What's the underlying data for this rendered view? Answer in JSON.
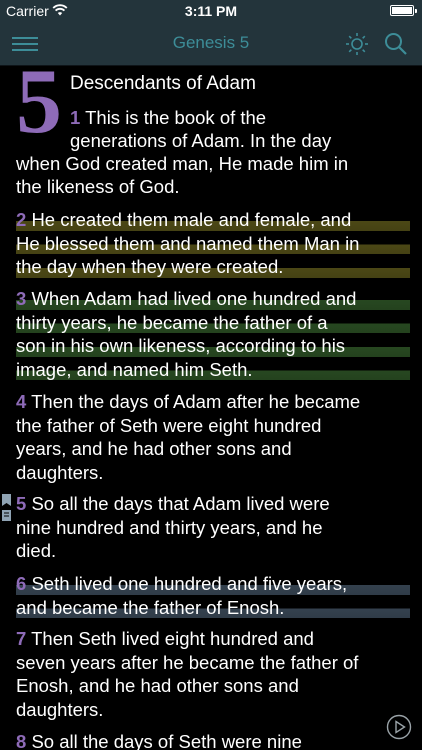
{
  "status": {
    "carrier": "Carrier",
    "time": "3:11 PM"
  },
  "nav": {
    "title": "Genesis 5"
  },
  "chapter": {
    "number": "5",
    "heading": "Descendants of Adam"
  },
  "verses": [
    {
      "num": "1",
      "lines": [
        "This is the book of the",
        "generations of Adam. In the day",
        "when God created man, He made him in",
        "the likeness of God."
      ]
    },
    {
      "num": "2",
      "lines": [
        "He created them male and female, and",
        "He blessed them and named them Man in",
        "the day when they were created."
      ]
    },
    {
      "num": "3",
      "lines": [
        "When Adam had lived one hundred and",
        "thirty years, he became the father of a",
        "son in his own likeness, according to his",
        "image, and named him Seth."
      ]
    },
    {
      "num": "4",
      "lines": [
        "Then the days of Adam after he became",
        "the father of Seth were eight hundred",
        "years, and he had other sons and",
        "daughters."
      ]
    },
    {
      "num": "5",
      "lines": [
        "So all the days that Adam lived were",
        "nine hundred and thirty years, and he",
        "died."
      ]
    },
    {
      "num": "6",
      "lines": [
        "Seth lived one hundred and five years,",
        "and became the father of Enosh."
      ]
    },
    {
      "num": "7",
      "lines": [
        "Then Seth lived eight hundred and",
        "seven years after he became the father of",
        "Enosh, and he had other sons and",
        "daughters."
      ]
    },
    {
      "num": "8",
      "lines": [
        "So all the days of Seth were nine"
      ]
    }
  ],
  "icons": {
    "menu": "menu-icon",
    "brightness": "brightness-icon",
    "search": "search-icon",
    "bookmark": "bookmark-icon",
    "play": "play-icon",
    "wifi": "wifi-icon",
    "battery": "battery-icon"
  },
  "colors": {
    "bar": "#23343b",
    "accent": "#3d8d98",
    "verse_number": "#8e6bb8",
    "highlight_yellow": "#7e7824",
    "highlight_green": "#3c6e32",
    "highlight_blue": "#506478"
  }
}
